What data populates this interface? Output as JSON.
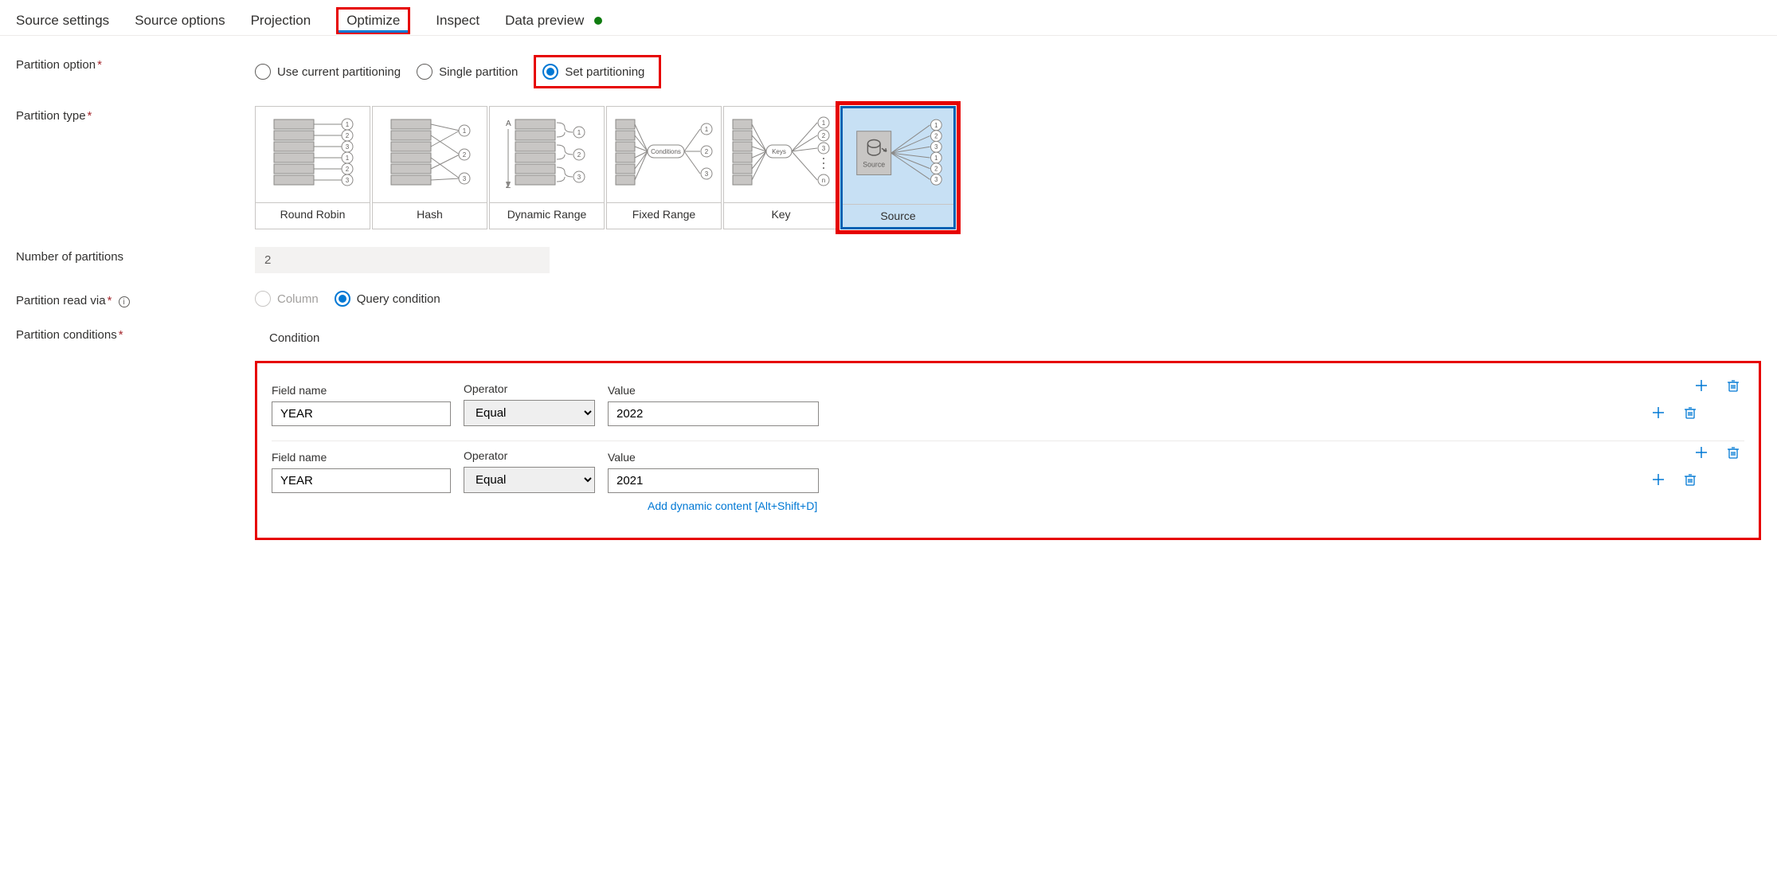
{
  "tabs": {
    "source_settings": "Source settings",
    "source_options": "Source options",
    "projection": "Projection",
    "optimize": "Optimize",
    "inspect": "Inspect",
    "data_preview": "Data preview"
  },
  "labels": {
    "partition_option": "Partition option",
    "partition_type": "Partition type",
    "num_partitions": "Number of partitions",
    "partition_read_via": "Partition read via",
    "partition_conditions": "Partition conditions",
    "condition": "Condition",
    "field_name": "Field name",
    "operator": "Operator",
    "value": "Value",
    "add_dynamic": "Add dynamic content [Alt+Shift+D]"
  },
  "partition_option": {
    "options": {
      "current": "Use current partitioning",
      "single": "Single partition",
      "set": "Set partitioning"
    },
    "selected": "set"
  },
  "partition_type": {
    "options": {
      "round_robin": "Round Robin",
      "hash": "Hash",
      "dynamic_range": "Dynamic Range",
      "fixed_range": "Fixed Range",
      "key": "Key",
      "source": "Source"
    },
    "selected": "source"
  },
  "num_partitions_value": "2",
  "partition_read_via": {
    "options": {
      "column": "Column",
      "query": "Query condition"
    },
    "selected": "query"
  },
  "conditions": [
    {
      "field": "YEAR",
      "operator": "Equal",
      "value": "2022"
    },
    {
      "field": "YEAR",
      "operator": "Equal",
      "value": "2021"
    }
  ],
  "icons": {
    "plus": "plus-icon",
    "trash": "trash-icon"
  }
}
